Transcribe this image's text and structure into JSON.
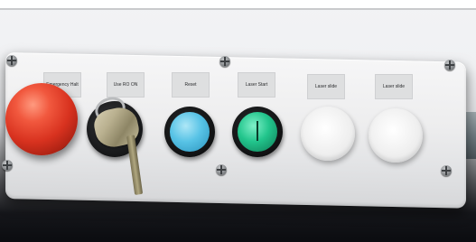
{
  "panel": {
    "labels": [
      "Emergency Halt",
      "Use RO ON",
      "Reset",
      "Laser Start",
      "Laser slide",
      "Laser slide"
    ]
  },
  "colors": {
    "estop": "#d8321f",
    "blue_button": "#58c3e6",
    "green_button": "#22c58c",
    "white_button": "#eeeeee",
    "panel": "#ededee"
  },
  "icons": {
    "screw": "screw-icon",
    "estop": "emergency-stop-icon",
    "key": "key-icon"
  }
}
